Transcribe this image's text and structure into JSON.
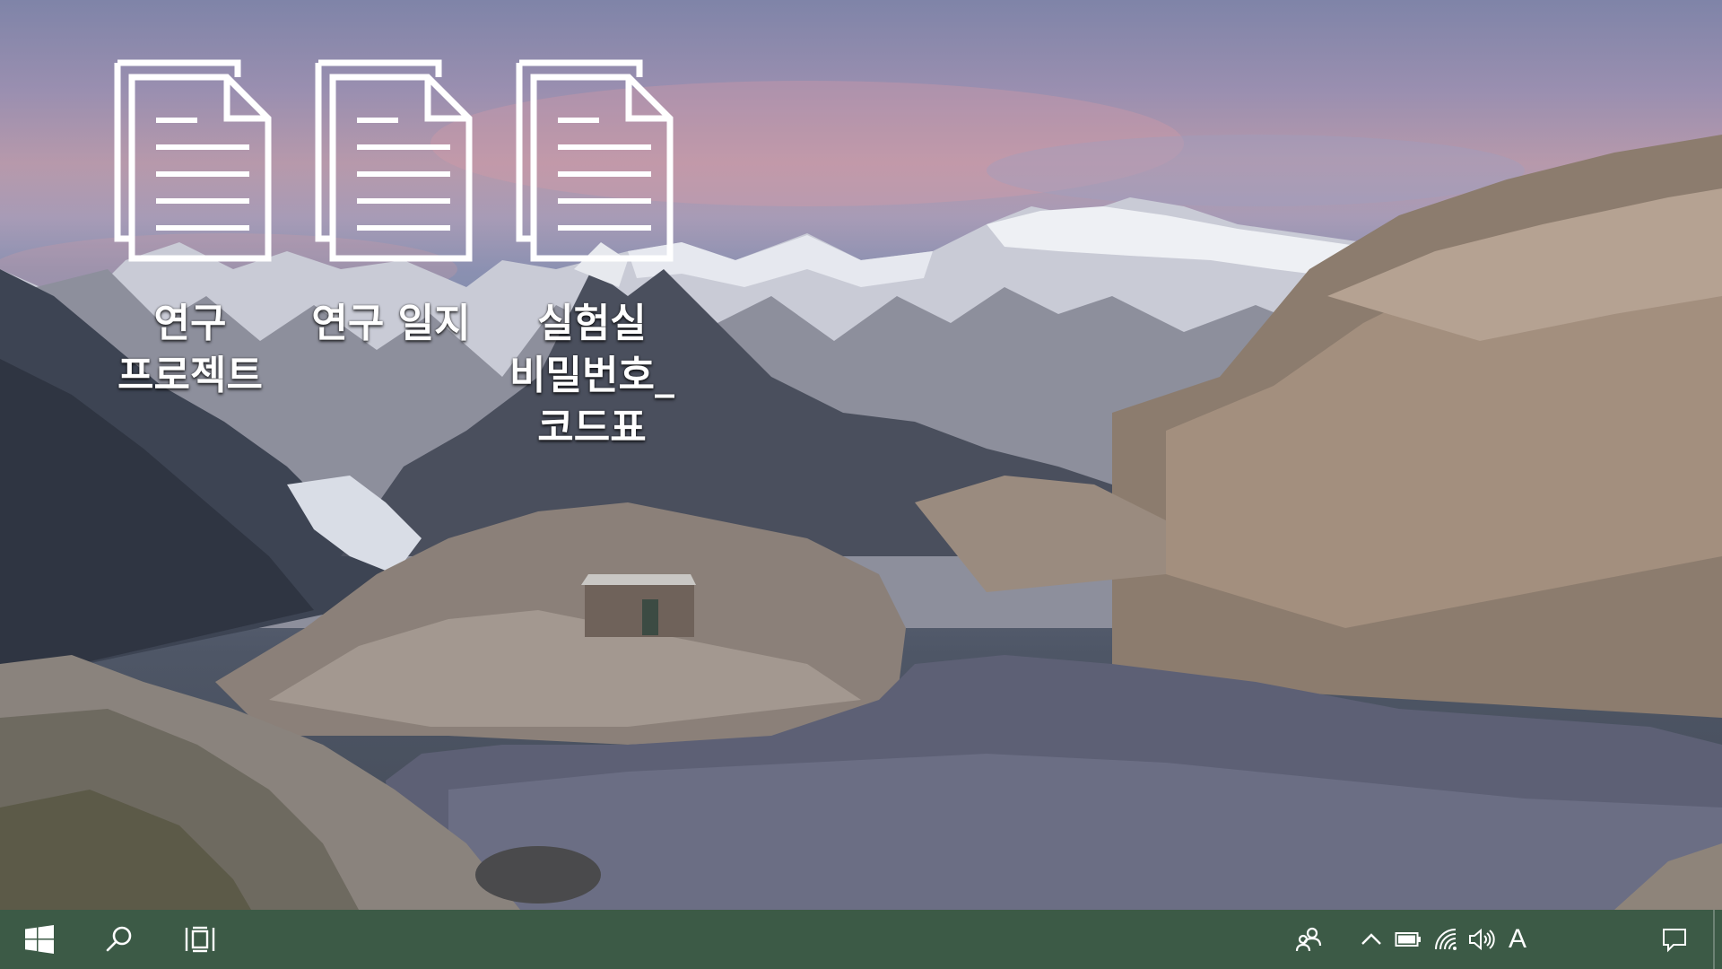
{
  "desktop": {
    "icons": [
      {
        "label": "연구 프로젝트",
        "icon": "document-icon"
      },
      {
        "label": "연구 일지",
        "icon": "document-icon"
      },
      {
        "label": "실험실 비밀번호_코드표",
        "icon": "document-icon"
      }
    ]
  },
  "taskbar": {
    "color": "#3c5a46",
    "left_icons": [
      "windows-start-icon",
      "search-icon",
      "task-view-icon"
    ],
    "tray_icons": [
      "people-icon",
      "chevron-up-icon",
      "battery-icon",
      "wifi-icon",
      "volume-icon"
    ],
    "ime_indicator": "A",
    "notification_icon": "action-center-icon"
  }
}
